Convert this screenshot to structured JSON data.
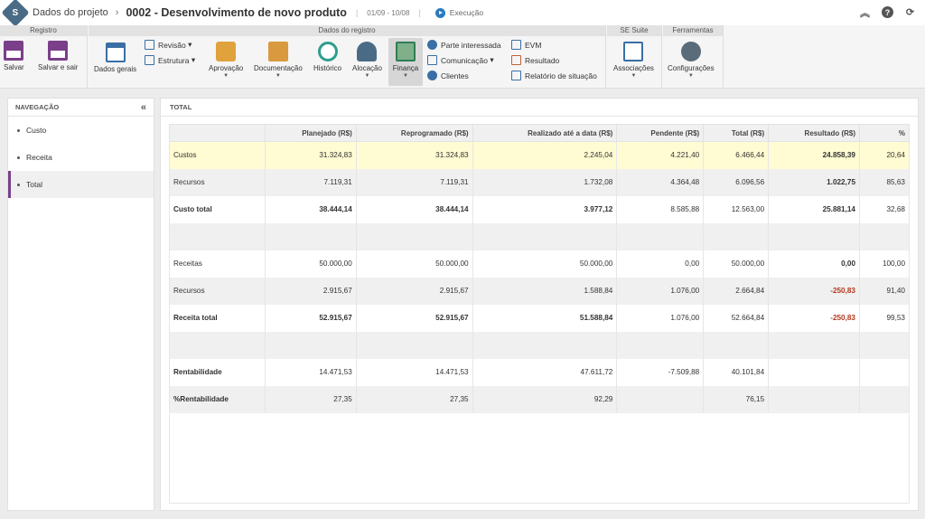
{
  "header": {
    "breadcrumb": "Dados do projeto",
    "project_title": "0002 - Desenvolvimento de novo produto",
    "dates": "01/09 - 10/08",
    "status": "Execução",
    "logo_letter": "S"
  },
  "ribbon": {
    "groups": {
      "registro": "Registro",
      "dados": "Dados do registro",
      "suite": "SE Suite",
      "ferramentas": "Ferramentas"
    },
    "salvar": "Salvar",
    "salvar_sair": "Salvar e sair",
    "dados_gerais": "Dados gerais",
    "revisao": "Revisão",
    "estrutura": "Estrutura",
    "aprovacao": "Aprovação",
    "documentacao": "Documentação",
    "historico": "Histórico",
    "alocacao": "Alocação",
    "financa": "Finança",
    "parte": "Parte interessada",
    "comunicacao": "Comunicação",
    "clientes": "Clientes",
    "evm": "EVM",
    "resultado": "Resultado",
    "relatorio": "Relatório de situação",
    "associacoes": "Associações",
    "configuracoes": "Configurações"
  },
  "nav": {
    "title": "NAVEGAÇÃO",
    "items": [
      "Custo",
      "Receita",
      "Total"
    ],
    "selected": "Total"
  },
  "main": {
    "title": "TOTAL"
  },
  "table": {
    "headers": [
      "",
      "Planejado (R$)",
      "Reprogramado (R$)",
      "Realizado até a data (R$)",
      "Pendente (R$)",
      "Total (R$)",
      "Resultado (R$)",
      "%"
    ],
    "rows": [
      {
        "cells": [
          "Custos",
          "31.324,83",
          "31.324,83",
          "2.245,04",
          "4.221,40",
          "6.466,44",
          "24.858,39",
          "20,64"
        ]
      },
      {
        "cells": [
          "Recursos",
          "7.119,31",
          "7.119,31",
          "1.732,08",
          "4.364,48",
          "6.096,56",
          "1.022,75",
          "85,63"
        ]
      },
      {
        "cells": [
          "Custo total",
          "38.444,14",
          "38.444,14",
          "3.977,12",
          "8.585,88",
          "12.563,00",
          "25.881,14",
          "32,68"
        ]
      },
      {
        "cells": [
          "",
          "",
          "",
          "",
          "",
          "",
          "",
          ""
        ]
      },
      {
        "cells": [
          "Receitas",
          "50.000,00",
          "50.000,00",
          "50.000,00",
          "0,00",
          "50.000,00",
          "0,00",
          "100,00"
        ]
      },
      {
        "cells": [
          "Recursos",
          "2.915,67",
          "2.915,67",
          "1.588,84",
          "1.076,00",
          "2.664,84",
          "-250,83",
          "91,40"
        ]
      },
      {
        "cells": [
          "Receita total",
          "52.915,67",
          "52.915,67",
          "51.588,84",
          "1.076,00",
          "52.664,84",
          "-250,83",
          "99,53"
        ]
      },
      {
        "cells": [
          "",
          "",
          "",
          "",
          "",
          "",
          "",
          ""
        ]
      },
      {
        "cells": [
          "Rentabilidade",
          "14.471,53",
          "14.471,53",
          "47.611,72",
          "-7.509,88",
          "40.101,84",
          "",
          ""
        ]
      },
      {
        "cells": [
          "%Rentabilidade",
          "27,35",
          "27,35",
          "92,29",
          "",
          "76,15",
          "",
          ""
        ]
      }
    ]
  },
  "colors": {
    "accent": "#7b3f8a",
    "negative": "#b23a1f",
    "highlight": "#fffbd2"
  }
}
